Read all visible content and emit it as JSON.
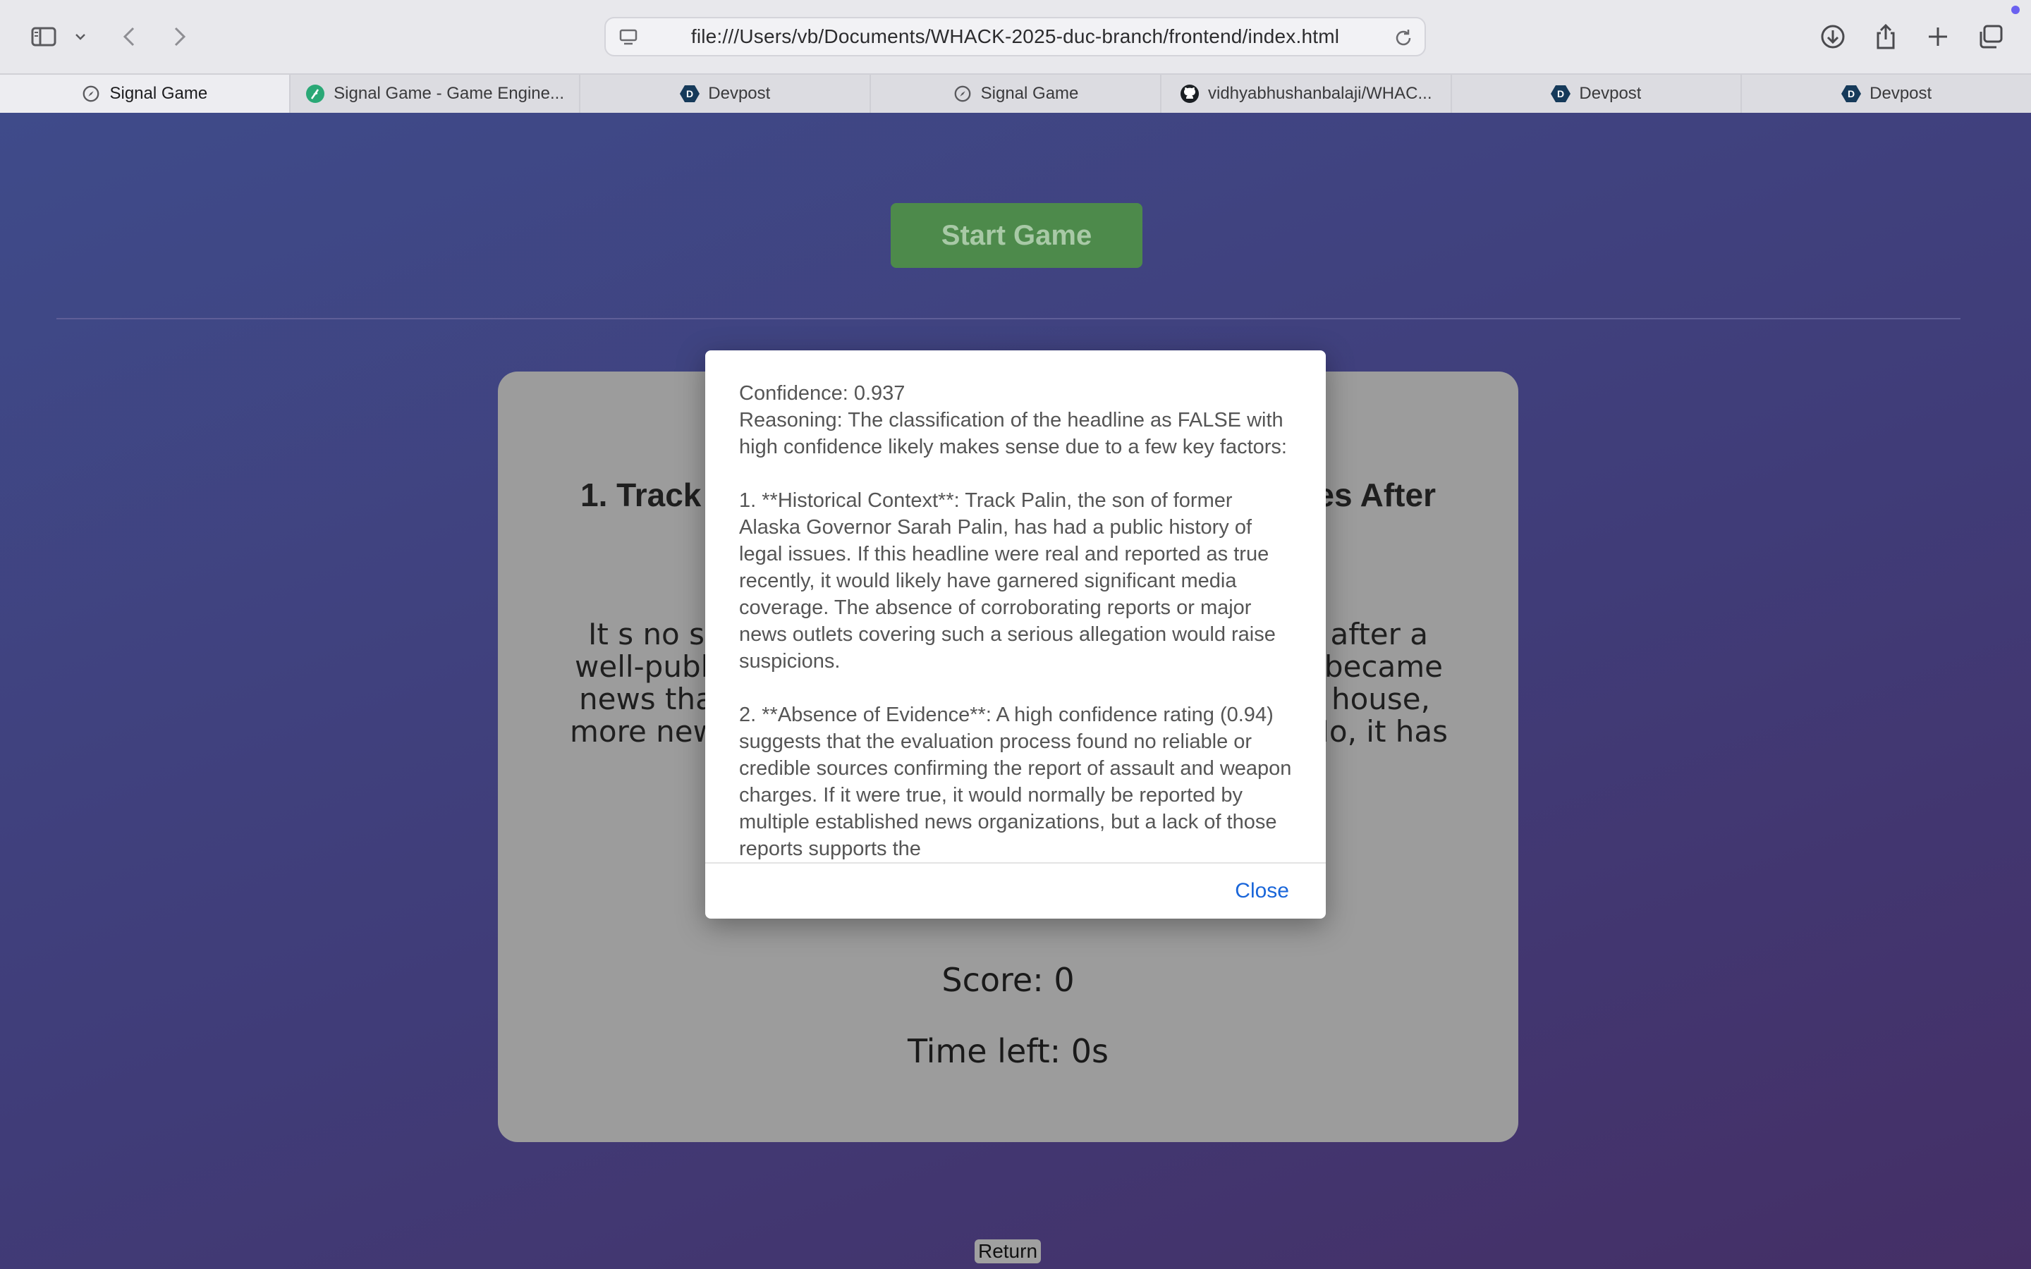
{
  "browser": {
    "url": "file:///Users/vb/Documents/WHACK-2025-duc-branch/frontend/index.html",
    "tabs": [
      {
        "label": "Signal Game",
        "icon": "compass-icon",
        "active": true
      },
      {
        "label": "Signal Game - Game Engine...",
        "icon": "feather-icon",
        "active": false
      },
      {
        "label": "Devpost",
        "icon": "devpost-icon",
        "active": false
      },
      {
        "label": "Signal Game",
        "icon": "compass-icon",
        "active": false
      },
      {
        "label": "vidhyabhushanbalaji/WHAC...",
        "icon": "github-icon",
        "active": false
      },
      {
        "label": "Devpost",
        "icon": "devpost-icon",
        "active": false
      },
      {
        "label": "Devpost",
        "icon": "devpost-icon",
        "active": false
      }
    ]
  },
  "game": {
    "start_label": "Start Game",
    "headline_left": "1. Track",
    "headline_right": "es After",
    "article_lines": [
      {
        "left": "It s no se",
        "right": "s after a"
      },
      {
        "left": "well-public",
        "right": "t became"
      },
      {
        "left": "news that",
        "right": "r house,"
      },
      {
        "left": "more news",
        "right": "No, it has"
      }
    ],
    "score": "Score: 0",
    "time_left": "Time left: 0s",
    "return_label": "Return"
  },
  "modal": {
    "confidence": "Confidence: 0.937",
    "reasoning": "Reasoning: The classification of the headline as FALSE with high confidence likely makes sense due to a few key factors:",
    "point1": "1. **Historical Context**: Track Palin, the son of former Alaska Governor Sarah Palin, has had a public history of legal issues. If this headline were real and reported as true recently, it would likely have garnered significant media coverage. The absence of corroborating reports or major news outlets covering such a serious allegation would raise suspicions.",
    "point2": "2. **Absence of Evidence**: A high confidence rating (0.94) suggests that the evaluation process found no reliable or credible sources confirming the report of assault and weapon charges. If it were true, it would normally be reported by multiple established news organizations, but a lack of those reports supports the",
    "close_label": "Close"
  },
  "colors": {
    "accent_link": "#1a66d9",
    "start_button": "#4d8a4b",
    "card": "#9c9c9c"
  }
}
